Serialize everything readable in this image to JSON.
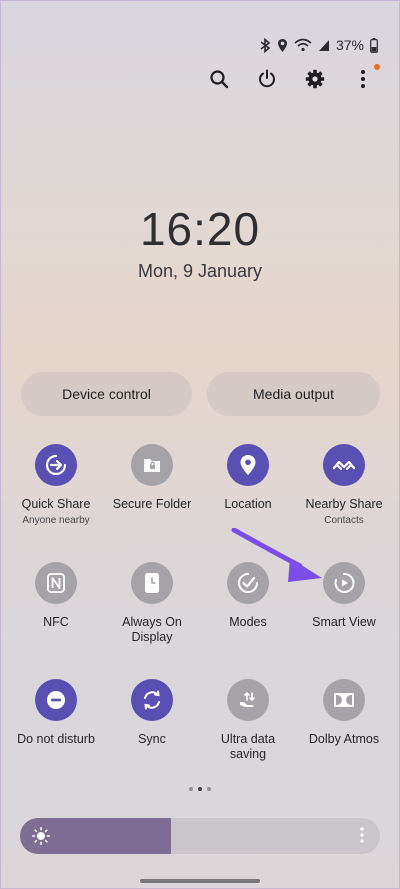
{
  "status": {
    "battery": "37%"
  },
  "clock": {
    "time": "16:20",
    "date": "Mon, 9 January"
  },
  "pills": {
    "left": "Device control",
    "right": "Media output"
  },
  "tiles": [
    {
      "label": "Quick Share",
      "sub": "Anyone nearby",
      "icon": "quick-share-icon",
      "active": true
    },
    {
      "label": "Secure Folder",
      "sub": "",
      "icon": "secure-folder-icon",
      "active": false
    },
    {
      "label": "Location",
      "sub": "",
      "icon": "location-pin-icon",
      "active": true
    },
    {
      "label": "Nearby Share",
      "sub": "Contacts",
      "icon": "nearby-share-icon",
      "active": true
    },
    {
      "label": "NFC",
      "sub": "",
      "icon": "nfc-icon",
      "active": false
    },
    {
      "label": "Always On Display",
      "sub": "",
      "icon": "always-on-display-icon",
      "active": false
    },
    {
      "label": "Modes",
      "sub": "",
      "icon": "modes-icon",
      "active": false
    },
    {
      "label": "Smart View",
      "sub": "",
      "icon": "smart-view-icon",
      "active": false
    },
    {
      "label": "Do not disturb",
      "sub": "",
      "icon": "do-not-disturb-icon",
      "active": true
    },
    {
      "label": "Sync",
      "sub": "",
      "icon": "sync-icon",
      "active": true
    },
    {
      "label": "Ultra data saving",
      "sub": "",
      "icon": "ultra-data-saving-icon",
      "active": false
    },
    {
      "label": "Dolby Atmos",
      "sub": "",
      "icon": "dolby-atmos-icon",
      "active": false
    }
  ],
  "brightness": {
    "level": 0.42
  },
  "colors": {
    "accent": "#5a4fb3",
    "arrow": "#7b4fe6",
    "inactive": "#a6a3a8"
  }
}
